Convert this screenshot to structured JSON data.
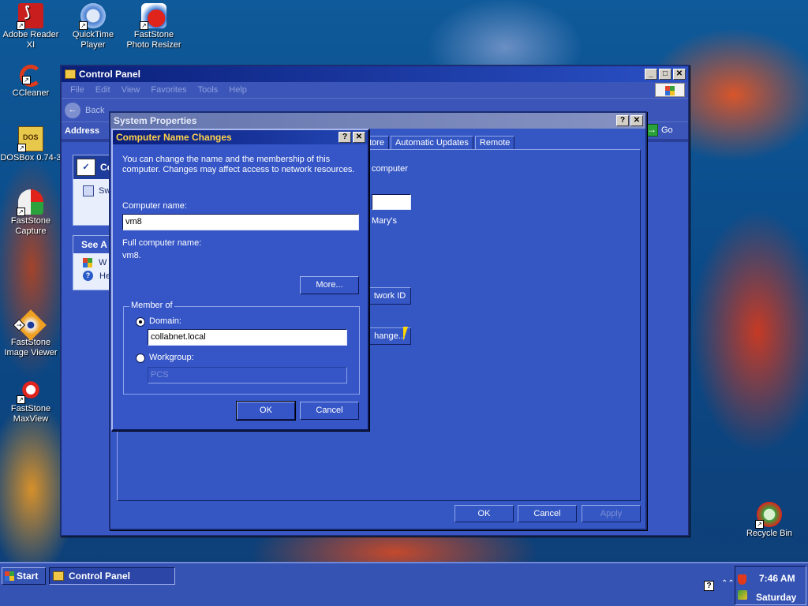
{
  "desktop": {
    "icons": [
      {
        "label": "Adobe Reader XI",
        "icon": "pdf-icon"
      },
      {
        "label": "QuickTime Player",
        "icon": "quicktime-icon"
      },
      {
        "label": "FastStone Photo Resizer",
        "icon": "photo-resizer-icon"
      },
      {
        "label": "CCleaner",
        "icon": "ccleaner-icon"
      },
      {
        "label": "DOSBox 0.74-3",
        "icon": "dosbox-icon"
      },
      {
        "label": "FastStone Capture",
        "icon": "capture-icon"
      },
      {
        "label": "FastStone Image Viewer",
        "icon": "image-viewer-icon"
      },
      {
        "label": "FastStone MaxView",
        "icon": "maxview-icon"
      },
      {
        "label": "Recycle Bin",
        "icon": "recycle-bin-icon"
      }
    ]
  },
  "control_panel": {
    "title": "Control Panel",
    "menu": [
      "File",
      "Edit",
      "View",
      "Favorites",
      "Tools",
      "Help"
    ],
    "back_label": "Back",
    "address_label": "Address",
    "go_label": "Go",
    "side_panel": {
      "item1": "Co",
      "item2": "Sw",
      "see_also": "See A",
      "link1": "W",
      "link2": "He"
    }
  },
  "system_properties": {
    "title": "System Properties",
    "tabs": [
      "tore",
      "Automatic Updates",
      "Remote"
    ],
    "text_computer": "computer",
    "text_marys": "Mary's",
    "network_id_button": "twork ID",
    "change_button": "hange...",
    "ok_label": "OK",
    "cancel_label": "Cancel",
    "apply_label": "Apply"
  },
  "computer_name_changes": {
    "title": "Computer Name Changes",
    "description": "You can change the name and the membership of this computer. Changes may affect access to network resources.",
    "computer_name_label": "Computer name:",
    "computer_name_value": "vm8",
    "full_name_label": "Full computer name:",
    "full_name_value": "vm8.",
    "more_button": "More...",
    "member_of_label": "Member of",
    "domain_label": "Domain:",
    "domain_value": "collabnet.local",
    "workgroup_label": "Workgroup:",
    "workgroup_value": "PCS",
    "ok_label": "OK",
    "cancel_label": "Cancel",
    "selected": "Domain"
  },
  "taskbar": {
    "start_label": "Start",
    "task_label": "Control Panel",
    "time": "7:46 AM",
    "day": "Saturday"
  }
}
